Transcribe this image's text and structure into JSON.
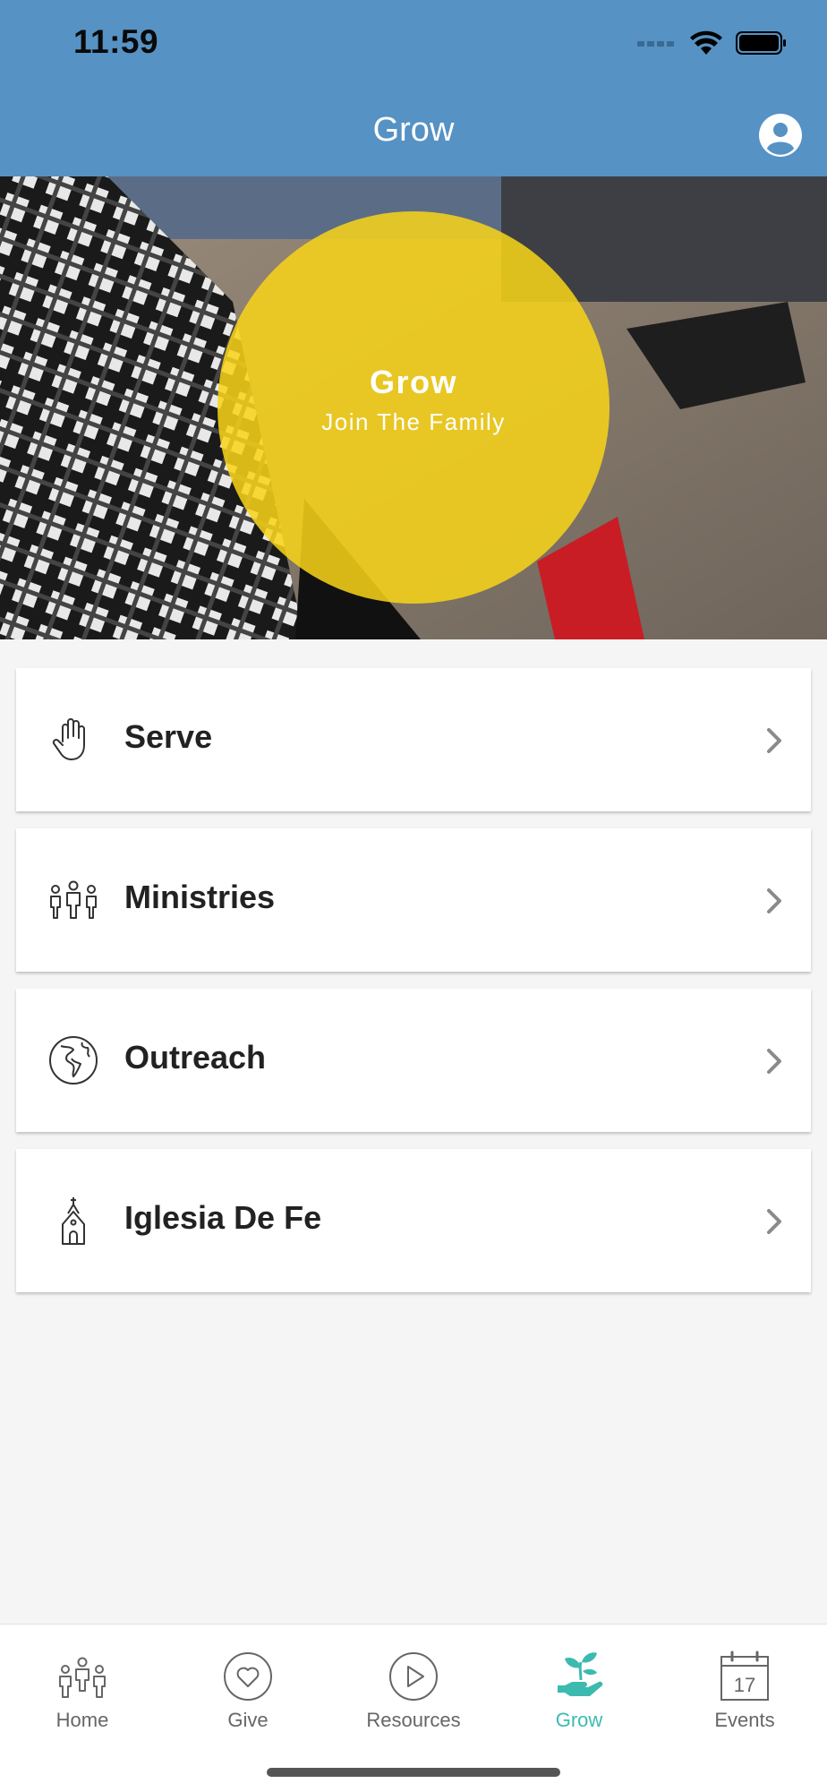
{
  "status_bar": {
    "time": "11:59"
  },
  "header": {
    "title": "Grow",
    "profile_icon": "person-circle-icon"
  },
  "hero": {
    "title": "Grow",
    "subtitle": "Join The Family",
    "circle_color": "#f8d418"
  },
  "menu": [
    {
      "label": "Serve",
      "icon": "raised-hand-icon"
    },
    {
      "label": "Ministries",
      "icon": "people-group-icon"
    },
    {
      "label": "Outreach",
      "icon": "globe-icon"
    },
    {
      "label": "Iglesia De Fe",
      "icon": "church-icon"
    }
  ],
  "tabs": [
    {
      "label": "Home",
      "icon": "people-icon",
      "active": false
    },
    {
      "label": "Give",
      "icon": "heart-icon",
      "active": false
    },
    {
      "label": "Resources",
      "icon": "play-icon",
      "active": false
    },
    {
      "label": "Grow",
      "icon": "sprout-hand-icon",
      "active": true
    },
    {
      "label": "Events",
      "icon": "calendar-icon",
      "active": false,
      "calendar_day": "17"
    }
  ],
  "colors": {
    "header": "#5692c4",
    "accent": "#3dbab0",
    "background": "#f5f5f5"
  }
}
